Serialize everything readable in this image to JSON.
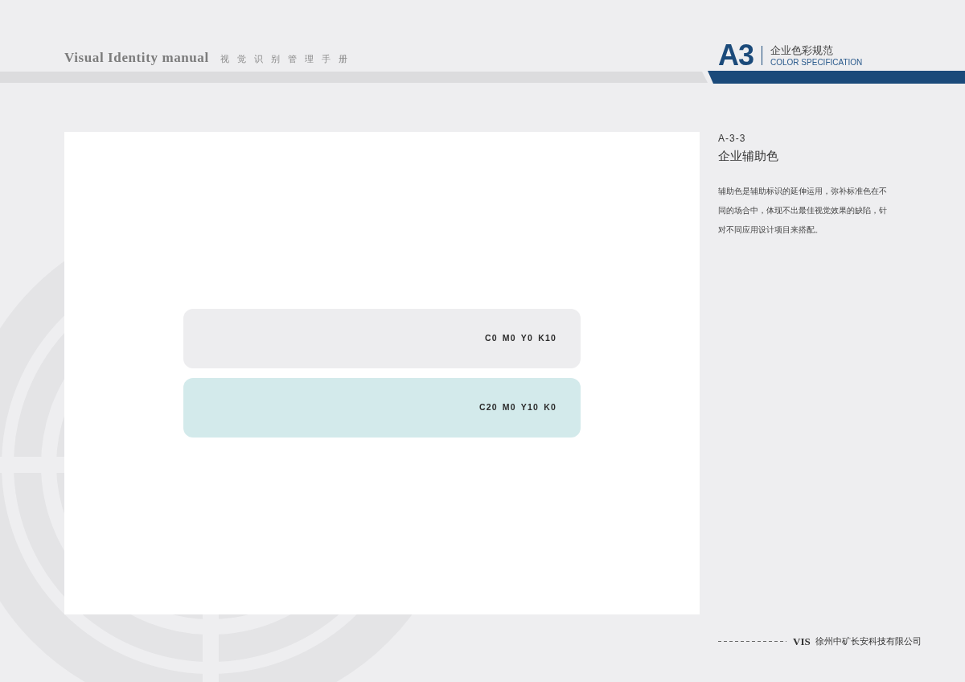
{
  "header": {
    "title": "Visual Identity manual",
    "subtitle": "视觉识别管理手册"
  },
  "section_badge": {
    "code": "A3",
    "title": "企业色彩规范",
    "subtitle": "COLOR SPECIFICATION"
  },
  "swatches": [
    {
      "label": "C0 M0 Y0 K10",
      "color": "#ededef"
    },
    {
      "label": "C20 M0 Y10 K0",
      "color": "#d3eaeb"
    }
  ],
  "description": {
    "code": "A-3-3",
    "heading": "企业辅助色",
    "body": "辅助色是辅助标识的延伸运用，弥补标准色在不同的场合中，体现不出最佳视觉效果的缺陷，针对不同应用设计项目来搭配。"
  },
  "footer": {
    "mark": "VIS",
    "company": "徐州中矿长安科技有限公司"
  }
}
